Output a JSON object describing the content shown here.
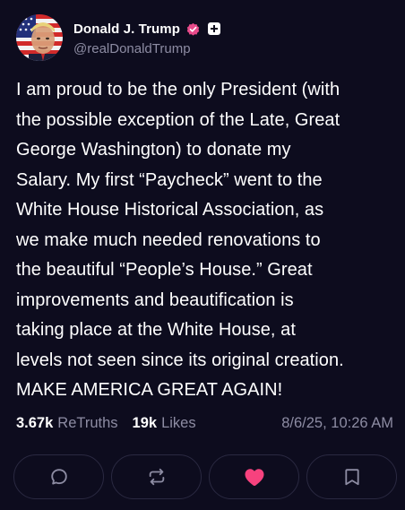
{
  "author": {
    "display_name": "Donald J. Trump",
    "handle": "@realDonaldTrump"
  },
  "post": {
    "text": "I am proud to be the only President (with\nthe possible exception of the Late, Great\nGeorge Washington) to donate my\nSalary. My first “Paycheck” went to the\nWhite House Historical Association, as\nwe make much needed renovations to\nthe beautiful “People’s House.” Great\nimprovements and beautification is\ntaking place at the White House, at\nlevels not seen since its original creation.\nMAKE AMERICA GREAT AGAIN!"
  },
  "stats": {
    "retruths_count": "3.67k",
    "retruths_label": "ReTruths",
    "likes_count": "19k",
    "likes_label": "Likes",
    "timestamp": "8/6/25, 10:26 AM"
  },
  "actions": [
    {
      "icon": "reply-icon"
    },
    {
      "icon": "retruth-icon"
    },
    {
      "icon": "heart-icon",
      "active": true,
      "color": "#f7427e"
    },
    {
      "icon": "bookmark-icon"
    }
  ],
  "colors": {
    "background": "#0d0c1e",
    "muted_text": "#8d8ca3",
    "verified_badge": "#e84a8a",
    "like_active": "#f7427e",
    "button_border": "#2a2941"
  }
}
